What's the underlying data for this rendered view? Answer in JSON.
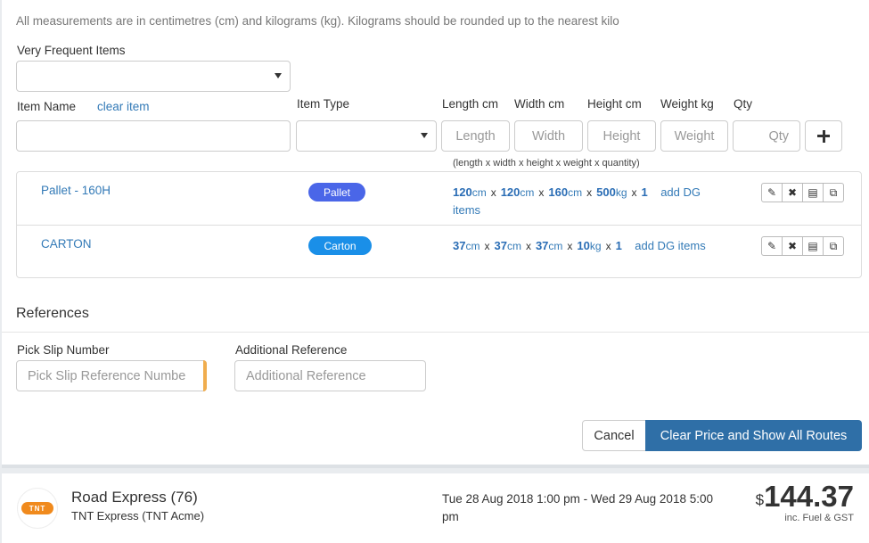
{
  "note": "All measurements are in centimetres (cm) and kilograms (kg). Kilograms should be rounded up to the nearest kilo",
  "frequent_items": {
    "label": "Very Frequent Items",
    "value": ""
  },
  "item_form": {
    "item_name_label": "Item Name",
    "clear_item": "clear item",
    "item_type_label": "Item Type",
    "length_label": "Length cm",
    "width_label": "Width cm",
    "height_label": "Height cm",
    "weight_label": "Weight kg",
    "qty_label": "Qty",
    "length_placeholder": "Length",
    "width_placeholder": "Width",
    "height_placeholder": "Height",
    "weight_placeholder": "Weight",
    "qty_placeholder": "Qty",
    "hint": "(length x  width x  height x  weight x  quantity)"
  },
  "items": [
    {
      "name": "Pallet - 160H",
      "type": "Pallet",
      "type_color": "#4a66e8",
      "length": "120",
      "width": "120",
      "height": "160",
      "weight": "500",
      "qty": "1",
      "dg_link": "add DG items",
      "unit_cm": "cm",
      "unit_kg": "kg",
      "x": "x"
    },
    {
      "name": "CARTON",
      "type": "Carton",
      "type_color": "#1a8fe8",
      "length": "37",
      "width": "37",
      "height": "37",
      "weight": "10",
      "qty": "1",
      "dg_link": "add DG items",
      "unit_cm": "cm",
      "unit_kg": "kg",
      "x": "x"
    }
  ],
  "references": {
    "title": "References",
    "pick_slip_label": "Pick Slip Number",
    "pick_slip_placeholder": "Pick Slip Reference Numbe",
    "additional_label": "Additional Reference",
    "additional_placeholder": "Additional Reference"
  },
  "buttons": {
    "cancel": "Cancel",
    "primary": "Clear Price and Show All Routes"
  },
  "route": {
    "logo_text": "TNT",
    "name": "Road Express (76)",
    "carrier": "TNT Express (TNT Acme)",
    "time": "Tue 28 Aug 2018 1:00 pm - Wed 29 Aug 2018 5:00 pm",
    "currency": "$",
    "price": "144.37",
    "price_note": "inc. Fuel & GST"
  }
}
